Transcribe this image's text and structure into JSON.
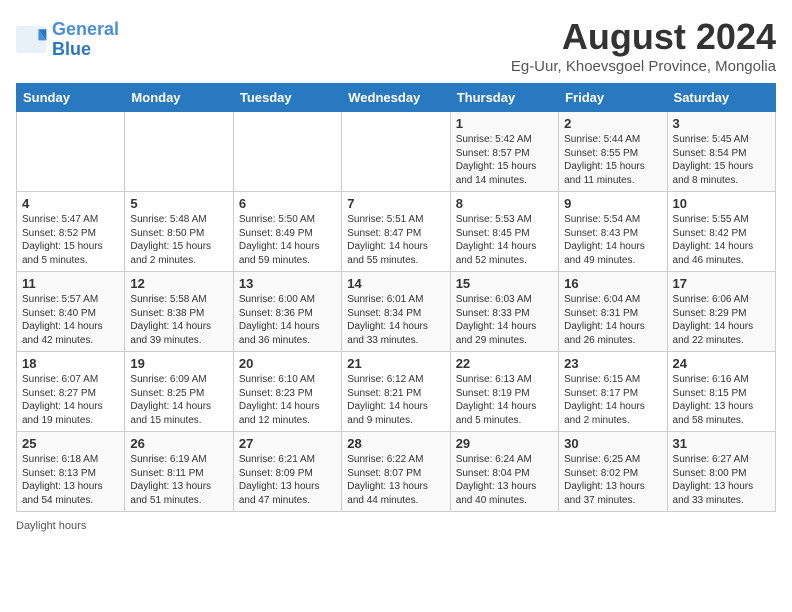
{
  "header": {
    "logo_line1": "General",
    "logo_line2": "Blue",
    "main_title": "August 2024",
    "subtitle": "Eg-Uur, Khoevsgoel Province, Mongolia"
  },
  "days_of_week": [
    "Sunday",
    "Monday",
    "Tuesday",
    "Wednesday",
    "Thursday",
    "Friday",
    "Saturday"
  ],
  "weeks": [
    [
      {
        "day": "",
        "info": ""
      },
      {
        "day": "",
        "info": ""
      },
      {
        "day": "",
        "info": ""
      },
      {
        "day": "",
        "info": ""
      },
      {
        "day": "1",
        "info": "Sunrise: 5:42 AM\nSunset: 8:57 PM\nDaylight: 15 hours\nand 14 minutes."
      },
      {
        "day": "2",
        "info": "Sunrise: 5:44 AM\nSunset: 8:55 PM\nDaylight: 15 hours\nand 11 minutes."
      },
      {
        "day": "3",
        "info": "Sunrise: 5:45 AM\nSunset: 8:54 PM\nDaylight: 15 hours\nand 8 minutes."
      }
    ],
    [
      {
        "day": "4",
        "info": "Sunrise: 5:47 AM\nSunset: 8:52 PM\nDaylight: 15 hours\nand 5 minutes."
      },
      {
        "day": "5",
        "info": "Sunrise: 5:48 AM\nSunset: 8:50 PM\nDaylight: 15 hours\nand 2 minutes."
      },
      {
        "day": "6",
        "info": "Sunrise: 5:50 AM\nSunset: 8:49 PM\nDaylight: 14 hours\nand 59 minutes."
      },
      {
        "day": "7",
        "info": "Sunrise: 5:51 AM\nSunset: 8:47 PM\nDaylight: 14 hours\nand 55 minutes."
      },
      {
        "day": "8",
        "info": "Sunrise: 5:53 AM\nSunset: 8:45 PM\nDaylight: 14 hours\nand 52 minutes."
      },
      {
        "day": "9",
        "info": "Sunrise: 5:54 AM\nSunset: 8:43 PM\nDaylight: 14 hours\nand 49 minutes."
      },
      {
        "day": "10",
        "info": "Sunrise: 5:55 AM\nSunset: 8:42 PM\nDaylight: 14 hours\nand 46 minutes."
      }
    ],
    [
      {
        "day": "11",
        "info": "Sunrise: 5:57 AM\nSunset: 8:40 PM\nDaylight: 14 hours\nand 42 minutes."
      },
      {
        "day": "12",
        "info": "Sunrise: 5:58 AM\nSunset: 8:38 PM\nDaylight: 14 hours\nand 39 minutes."
      },
      {
        "day": "13",
        "info": "Sunrise: 6:00 AM\nSunset: 8:36 PM\nDaylight: 14 hours\nand 36 minutes."
      },
      {
        "day": "14",
        "info": "Sunrise: 6:01 AM\nSunset: 8:34 PM\nDaylight: 14 hours\nand 33 minutes."
      },
      {
        "day": "15",
        "info": "Sunrise: 6:03 AM\nSunset: 8:33 PM\nDaylight: 14 hours\nand 29 minutes."
      },
      {
        "day": "16",
        "info": "Sunrise: 6:04 AM\nSunset: 8:31 PM\nDaylight: 14 hours\nand 26 minutes."
      },
      {
        "day": "17",
        "info": "Sunrise: 6:06 AM\nSunset: 8:29 PM\nDaylight: 14 hours\nand 22 minutes."
      }
    ],
    [
      {
        "day": "18",
        "info": "Sunrise: 6:07 AM\nSunset: 8:27 PM\nDaylight: 14 hours\nand 19 minutes."
      },
      {
        "day": "19",
        "info": "Sunrise: 6:09 AM\nSunset: 8:25 PM\nDaylight: 14 hours\nand 15 minutes."
      },
      {
        "day": "20",
        "info": "Sunrise: 6:10 AM\nSunset: 8:23 PM\nDaylight: 14 hours\nand 12 minutes."
      },
      {
        "day": "21",
        "info": "Sunrise: 6:12 AM\nSunset: 8:21 PM\nDaylight: 14 hours\nand 9 minutes."
      },
      {
        "day": "22",
        "info": "Sunrise: 6:13 AM\nSunset: 8:19 PM\nDaylight: 14 hours\nand 5 minutes."
      },
      {
        "day": "23",
        "info": "Sunrise: 6:15 AM\nSunset: 8:17 PM\nDaylight: 14 hours\nand 2 minutes."
      },
      {
        "day": "24",
        "info": "Sunrise: 6:16 AM\nSunset: 8:15 PM\nDaylight: 13 hours\nand 58 minutes."
      }
    ],
    [
      {
        "day": "25",
        "info": "Sunrise: 6:18 AM\nSunset: 8:13 PM\nDaylight: 13 hours\nand 54 minutes."
      },
      {
        "day": "26",
        "info": "Sunrise: 6:19 AM\nSunset: 8:11 PM\nDaylight: 13 hours\nand 51 minutes."
      },
      {
        "day": "27",
        "info": "Sunrise: 6:21 AM\nSunset: 8:09 PM\nDaylight: 13 hours\nand 47 minutes."
      },
      {
        "day": "28",
        "info": "Sunrise: 6:22 AM\nSunset: 8:07 PM\nDaylight: 13 hours\nand 44 minutes."
      },
      {
        "day": "29",
        "info": "Sunrise: 6:24 AM\nSunset: 8:04 PM\nDaylight: 13 hours\nand 40 minutes."
      },
      {
        "day": "30",
        "info": "Sunrise: 6:25 AM\nSunset: 8:02 PM\nDaylight: 13 hours\nand 37 minutes."
      },
      {
        "day": "31",
        "info": "Sunrise: 6:27 AM\nSunset: 8:00 PM\nDaylight: 13 hours\nand 33 minutes."
      }
    ]
  ],
  "footer": {
    "daylight_label": "Daylight hours"
  },
  "colors": {
    "header_bg": "#2979c0",
    "accent_blue": "#4a90d9"
  }
}
